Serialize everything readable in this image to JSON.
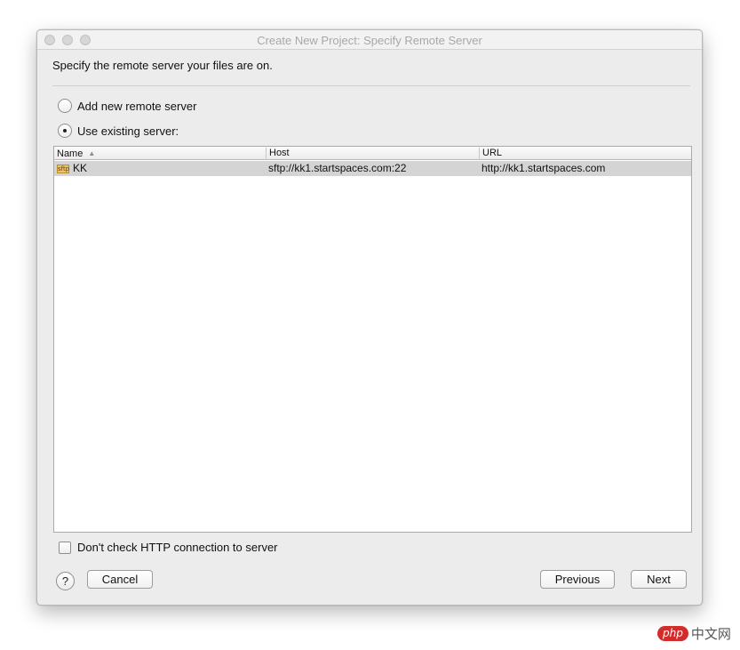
{
  "window": {
    "title": "Create New Project: Specify Remote Server"
  },
  "instruction": "Specify the remote server your files are on.",
  "options": {
    "add_new": "Add new remote server",
    "use_existing": "Use existing server:"
  },
  "table": {
    "columns": [
      "Name",
      "Host",
      "URL"
    ],
    "rows": [
      {
        "icon_text": "sftp",
        "name": "KK",
        "host": "sftp://kk1.startspaces.com:22",
        "url": "http://kk1.startspaces.com"
      }
    ]
  },
  "checkbox_label": "Don't check HTTP connection to server",
  "buttons": {
    "help": "?",
    "cancel": "Cancel",
    "previous": "Previous",
    "next": "Next"
  },
  "watermark": {
    "badge": "php",
    "text": "中文网"
  }
}
